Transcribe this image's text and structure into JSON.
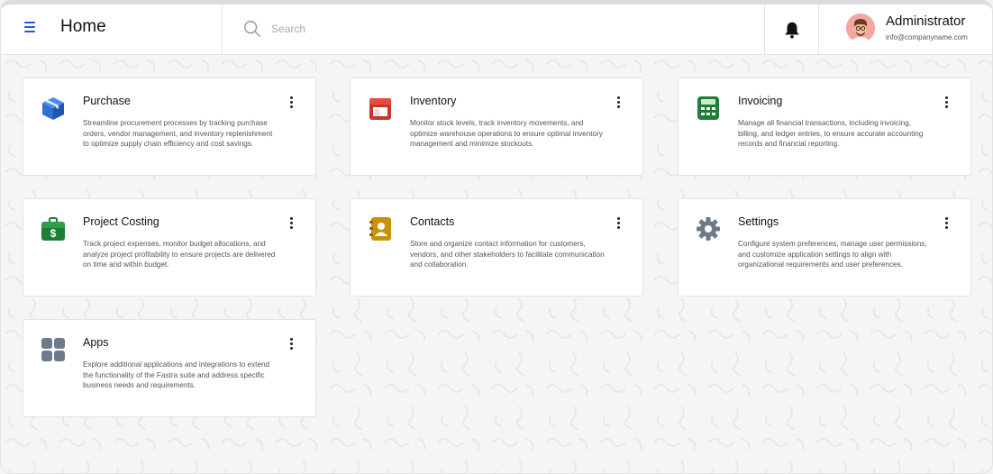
{
  "header": {
    "title": "Home",
    "menu_icon": "hamburger-menu-icon",
    "search": {
      "placeholder": "Search",
      "value": ""
    },
    "notifications_icon": "bell-icon",
    "user": {
      "name": "Administrator",
      "email": "info@companyname.com",
      "avatar": "avatar-illustration"
    }
  },
  "cards": [
    {
      "title": "Purchase",
      "icon": "box-icon",
      "color": "#2f6fd6",
      "description": "Streamline procurement processes by tracking purchase orders, vendor management, and inventory replenishment to optimize supply chain efficiency and cost savings."
    },
    {
      "title": "Inventory",
      "icon": "store-icon",
      "color": "#c0392b",
      "description": "Monitor stock levels, track inventory movements, and optimize warehouse operations to ensure optimal inventory management and minimize stockouts."
    },
    {
      "title": "Invoicing",
      "icon": "calculator-icon",
      "color": "#1e7e34",
      "description": "Manage all financial transactions, including invoicing, billing, and ledger entries, to ensure accurate accounting records and financial reporting."
    },
    {
      "title": "Project Costing",
      "icon": "briefcase-dollar-icon",
      "color": "#1e7e34",
      "description": "Track project expenses, monitor budget allocations, and analyze project profitability to ensure projects are delivered on time and within budget."
    },
    {
      "title": "Contacts",
      "icon": "address-book-icon",
      "color": "#c9920a",
      "description": "Store and organize contact information for customers, vendors, and other stakeholders to facilitate communication and collaboration."
    },
    {
      "title": "Settings",
      "icon": "gear-icon",
      "color": "#6c7a89",
      "description": "Configure system preferences, manage user permissions, and customize application settings to align with organizational requirements and user preferences."
    },
    {
      "title": "Apps",
      "icon": "apps-grid-icon",
      "color": "#6c7a89",
      "description": "Explore additional applications and integrations to extend the functionality of the Fastra suite and address specific business needs and requirements."
    }
  ]
}
